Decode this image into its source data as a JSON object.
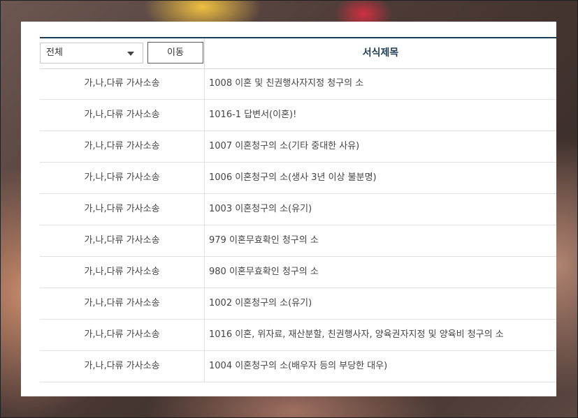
{
  "filter": {
    "selected": "전체",
    "go_label": "이동"
  },
  "table": {
    "header_title": "서식제목",
    "rows": [
      {
        "category": "가,나,다류 가사소송",
        "title": "1008 이혼 및 친권행사자지정 청구의 소"
      },
      {
        "category": "가,나,다류 가사소송",
        "title": "1016-1 답변서(이혼)!"
      },
      {
        "category": "가,나,다류 가사소송",
        "title": "1007 이혼청구의 소(기타 중대한 사유)"
      },
      {
        "category": "가,나,다류 가사소송",
        "title": "1006 이혼청구의 소(생사 3년 이상 불분명)"
      },
      {
        "category": "가,나,다류 가사소송",
        "title": "1003 이혼청구의 소(유기)"
      },
      {
        "category": "가,나,다류 가사소송",
        "title": "979 이혼무효확인 청구의 소"
      },
      {
        "category": "가,나,다류 가사소송",
        "title": "980 이혼무효확인 청구의 소"
      },
      {
        "category": "가,나,다류 가사소송",
        "title": "1002 이혼청구의 소(유기)"
      },
      {
        "category": "가,나,다류 가사소송",
        "title": "1016 이혼, 위자료, 재산분할, 친권행사자, 양육권자지정 및 양육비 청구의 소"
      },
      {
        "category": "가,나,다류 가사소송",
        "title": "1004 이혼청구의 소(배우자 등의 부당한 대우)"
      }
    ]
  },
  "colors": {
    "header_accent": "#1e3d55",
    "row_border": "#e2e2e2"
  },
  "icons": {
    "select_arrow": "caret-down-icon"
  }
}
